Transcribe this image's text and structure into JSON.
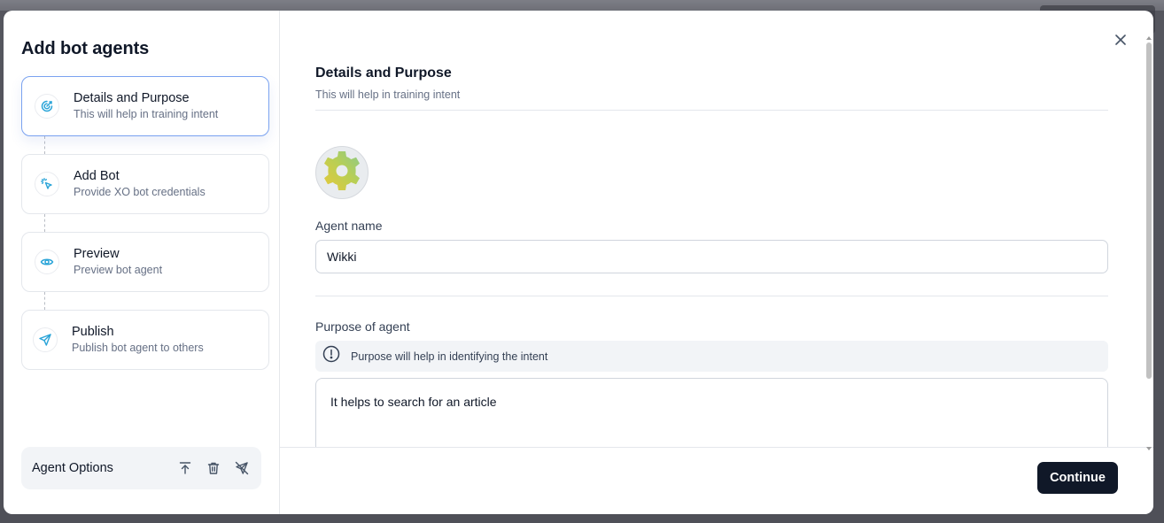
{
  "modal": {
    "title": "Add bot agents",
    "close_icon": "close-icon"
  },
  "steps": [
    {
      "title": "Details and Purpose",
      "subtitle": "This will help in training intent",
      "icon": "target-icon",
      "active": true
    },
    {
      "title": "Add Bot",
      "subtitle": "Provide XO bot credentials",
      "icon": "cursor-click-icon",
      "active": false
    },
    {
      "title": "Preview",
      "subtitle": "Preview bot agent",
      "icon": "eye-icon",
      "active": false
    },
    {
      "title": "Publish",
      "subtitle": "Publish bot agent to others",
      "icon": "send-icon",
      "active": false
    }
  ],
  "agent_options": {
    "label": "Agent Options",
    "icons": [
      "upload-icon",
      "trash-icon",
      "send-off-icon"
    ]
  },
  "section": {
    "title": "Details and Purpose",
    "subtitle": "This will help in training intent"
  },
  "avatar": {
    "icon": "gear-icon"
  },
  "agent_name": {
    "label": "Agent name",
    "value": "Wikki"
  },
  "purpose": {
    "label": "Purpose of agent",
    "info": "Purpose will help in identifying the intent",
    "info_icon": "info-icon",
    "value": "It helps to search for an article"
  },
  "footer": {
    "continue_label": "Continue"
  },
  "colors": {
    "accent_border": "#7aa2f0",
    "icon_blue": "#2aa4d8",
    "primary_button": "#101828"
  }
}
